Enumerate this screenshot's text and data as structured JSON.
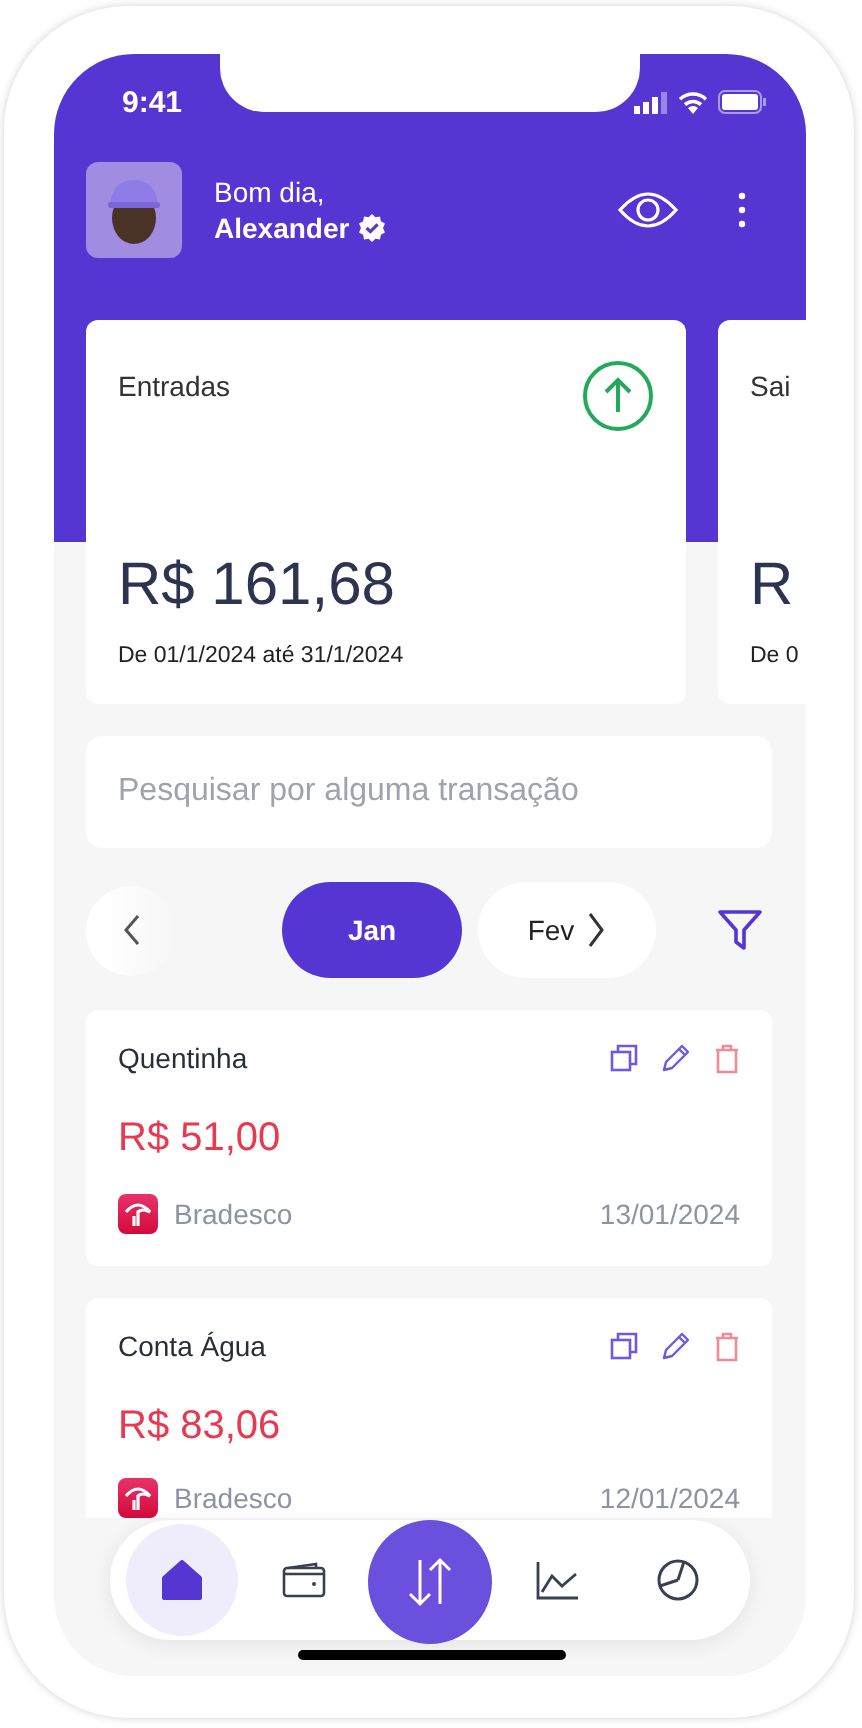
{
  "status_bar": {
    "time": "9:41"
  },
  "header": {
    "greeting": "Bom dia,",
    "name": "Alexander",
    "verified": true
  },
  "summary_cards": [
    {
      "kind": "income",
      "label": "Entradas",
      "amount": "R$ 161,68",
      "period": "De 01/1/2024 até 31/1/2024"
    },
    {
      "kind": "cut",
      "label": "Sai",
      "amount": "R",
      "period": "De 0"
    }
  ],
  "search": {
    "placeholder": "Pesquisar por alguma transação"
  },
  "months": [
    {
      "label": "Jan",
      "selected": true
    },
    {
      "label": "Fev",
      "selected": false
    }
  ],
  "transactions": [
    {
      "title": "Quentinha",
      "amount": "R$ 51,00",
      "kind": "expense",
      "bank": "Bradesco",
      "date": "13/01/2024"
    },
    {
      "title": "Conta Água",
      "amount": "R$ 83,06",
      "kind": "expense",
      "bank": "Bradesco",
      "date": "12/01/2024"
    }
  ],
  "nav": [
    {
      "kind": "home",
      "selected": true
    },
    {
      "kind": "wallet",
      "selected": false
    },
    {
      "kind": "transfer",
      "selected": false
    },
    {
      "kind": "chart",
      "selected": false
    },
    {
      "kind": "pie",
      "selected": false
    }
  ]
}
